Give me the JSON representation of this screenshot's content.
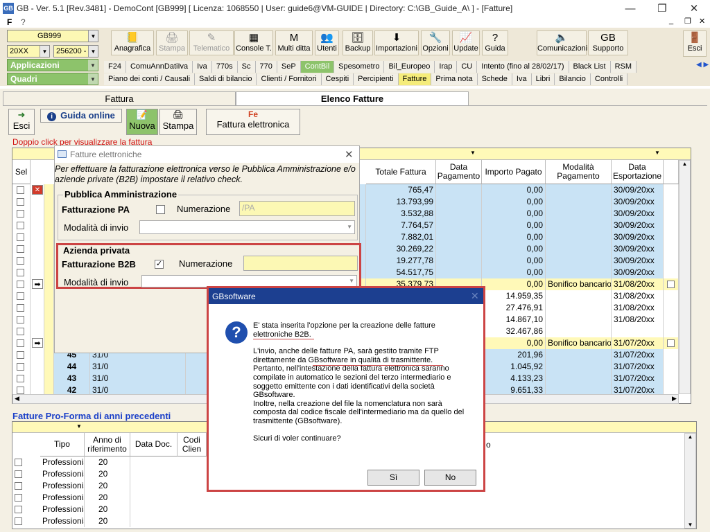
{
  "window": {
    "title": "GB - Ver. 5.1 [Rev.3481] -  DemoCont [GB999]    [ Licenza: 1068550 | User: guide6@VM-GUIDE | Directory: C:\\GB_Guide_A\\ ] - [Fatture]",
    "minimize": "—",
    "restore": "❐",
    "close": "✕",
    "mdi_min": "_",
    "mdi_restore": "❐",
    "mdi_close": "✕"
  },
  "menu": {
    "f": "F",
    "help": "?"
  },
  "combos": {
    "company": "GB999",
    "year": "20XX",
    "code": "256200 -"
  },
  "side": {
    "applicazioni": "Applicazioni",
    "quadri": "Quadri"
  },
  "toolbar": [
    {
      "label": "Anagrafica",
      "icon": "📒"
    },
    {
      "label": "Stampa",
      "icon": "🖨"
    },
    {
      "label": "Telematico",
      "icon": "✎"
    },
    {
      "label": "Console T.",
      "icon": "▦"
    },
    {
      "label": "Multi ditta",
      "icon": "M"
    },
    {
      "label": "Utenti",
      "icon": "👥"
    },
    {
      "label": "Backup",
      "icon": "🗄"
    },
    {
      "label": "Importazioni",
      "icon": "⬇"
    },
    {
      "label": "Opzioni",
      "icon": "🔧"
    },
    {
      "label": "Update",
      "icon": "📈"
    },
    {
      "label": "Guida",
      "icon": "?"
    }
  ],
  "toolbar_right": [
    {
      "label": "Comunicazioni",
      "icon": "🔈"
    },
    {
      "label": "Supporto",
      "icon": "GB"
    }
  ],
  "esci_top": "Esci",
  "tabs1": [
    "F24",
    "ComuAnnDatiIva",
    "Iva",
    "770s",
    "Sc",
    "770",
    "SeP",
    "ContBil",
    "Spesometro",
    "Bil_Europeo",
    "Irap",
    "CU",
    "Intento (fino al 28/02/17)",
    "Black List",
    "RSM"
  ],
  "tabs1_active": "ContBil",
  "tabs2": [
    "Piano dei conti / Causali",
    "Saldi di bilancio",
    "Clienti / Fornitori",
    "Cespiti",
    "Percipienti",
    "Fatture",
    "Prima nota",
    "Schede",
    "Iva",
    "Libri",
    "Bilancio",
    "Controlli"
  ],
  "tabs2_active": "Fatture",
  "subtabs": {
    "fattura": "Fattura",
    "elenco": "Elenco Fatture"
  },
  "actions": {
    "esci": "Esci",
    "guida": "Guida online",
    "nuova": "Nuova",
    "stampa": "Stampa",
    "fattura_el": "Fattura elettronica"
  },
  "hint": "Doppio click per visualizzare la fattura",
  "grid": {
    "headers": {
      "sel": "Sel",
      "totale": "Totale Fattura",
      "data_pag": "Data\nPagamento",
      "importo": "Importo Pagato",
      "modalita": "Modalità\nPagamento",
      "data_esp": "Data\nEsportazione"
    },
    "rows": [
      {
        "num": "",
        "data": "",
        "totale": "765,47",
        "importo": "0,00",
        "mod": "",
        "esp": "30/09/20xx"
      },
      {
        "num": "",
        "data": "",
        "totale": "13.793,99",
        "importo": "0,00",
        "mod": "",
        "esp": "30/09/20xx"
      },
      {
        "num": "",
        "data": "",
        "totale": "3.532,88",
        "importo": "0,00",
        "mod": "",
        "esp": "30/09/20xx"
      },
      {
        "num": "",
        "data": "",
        "totale": "7.764,57",
        "importo": "0,00",
        "mod": "",
        "esp": "30/09/20xx"
      },
      {
        "num": "",
        "data": "",
        "totale": "7.882,01",
        "importo": "0,00",
        "mod": "",
        "esp": "30/09/20xx"
      },
      {
        "num": "",
        "data": "",
        "totale": "30.269,22",
        "importo": "0,00",
        "mod": "",
        "esp": "30/09/20xx"
      },
      {
        "num": "",
        "data": "",
        "totale": "19.277,78",
        "importo": "0,00",
        "mod": "",
        "esp": "30/09/20xx"
      },
      {
        "num": "",
        "data": "",
        "totale": "54.517,75",
        "importo": "0,00",
        "mod": "",
        "esp": "30/09/20xx"
      },
      {
        "num": "",
        "data": "",
        "totale": "35.379,73",
        "importo": "0,00",
        "mod": "Bonifico bancario",
        "esp": "31/08/20xx"
      },
      {
        "num": "",
        "data": "",
        "totale": "",
        "importo": "14.959,35",
        "mod": "",
        "esp": "31/08/20xx"
      },
      {
        "num": "",
        "data": "",
        "totale": "",
        "importo": "27.476,91",
        "mod": "",
        "esp": "31/08/20xx"
      },
      {
        "num": "",
        "data": "",
        "totale": "",
        "importo": "14.867,10",
        "mod": "",
        "esp": "31/08/20xx"
      },
      {
        "num": "",
        "data": "",
        "totale": "",
        "importo": "32.467,86",
        "mod": "",
        "esp": ""
      },
      {
        "num": "",
        "data": "",
        "totale": "",
        "importo": "0,00",
        "mod": "Bonifico bancario",
        "esp": "31/07/20xx"
      },
      {
        "num": "45",
        "data": "31/0",
        "totale": "",
        "importo": "201,96",
        "mod": "",
        "esp": "31/07/20xx"
      },
      {
        "num": "44",
        "data": "31/0",
        "totale": "",
        "importo": "1.045,92",
        "mod": "",
        "esp": "31/07/20xx"
      },
      {
        "num": "43",
        "data": "31/0",
        "totale": "",
        "importo": "4.133,23",
        "mod": "",
        "esp": "31/07/20xx"
      },
      {
        "num": "42",
        "data": "31/0",
        "totale": "",
        "importo": "9.651,33",
        "mod": "",
        "esp": "31/07/20xx"
      }
    ]
  },
  "proforma": {
    "title": "Fatture Pro-Forma di anni precedenti",
    "headers": {
      "tipo": "Tipo",
      "anno": "Anno di\nriferimento",
      "data": "Data Doc.",
      "codice": "Codi\nClien",
      "o": "o"
    },
    "rows": [
      {
        "tipo": "Professionis",
        "anno": "20"
      },
      {
        "tipo": "Professionis",
        "anno": "20"
      },
      {
        "tipo": "Professionis",
        "anno": "20"
      },
      {
        "tipo": "Professionis",
        "anno": "20"
      },
      {
        "tipo": "Professionis",
        "anno": "20"
      },
      {
        "tipo": "Professionis",
        "anno": "20"
      }
    ]
  },
  "dialog_fe": {
    "title": "Fatture elettroniche",
    "intro": "Per effettuare la fatturazione elettronica verso le Pubblica Amministrazione e/o aziende private (B2B) impostare il relativo check.",
    "pa_group": "Pubblica Amministrazione",
    "pa_label": "Fatturazione PA",
    "pa_checked": "",
    "num_label": "Numerazione",
    "pa_num": "/PA",
    "invio_label": "Modalità di invio",
    "b2b_group": "Azienda privata",
    "b2b_label": "Fatturazione B2B",
    "b2b_checked": "✓",
    "b2b_num": ""
  },
  "dialog_msg": {
    "title": "GBsoftware",
    "p1": "E' stata inserita l'opzione per la creazione delle fatture elettroniche B2B.",
    "p2": "L'invio, anche delle fatture PA, sarà gestito tramite FTP direttamente da GBsoftware in qualità di trasmittente.",
    "p3": "Pertanto, nell'intestazione della fattura elettronica saranno compilate in automatico le sezioni del terzo intermediario e soggetto emittente con i dati identificativi della società GBsoftware.",
    "p4": "Inoltre, nella creazione del file la nomenclatura non sarà composta dal codice fiscale dell'intermediario ma da quello del trasmittente (GBsoftware).",
    "p5": "Sicuri di voler continuare?",
    "yes": "Sì",
    "no": "No"
  },
  "colors": {
    "accent_green": "#8dc36b",
    "row_blue": "#c9e3f5",
    "row_yellow": "#fff9b8",
    "highlight_red": "#cc4444",
    "link_blue": "#1a3fc8"
  }
}
